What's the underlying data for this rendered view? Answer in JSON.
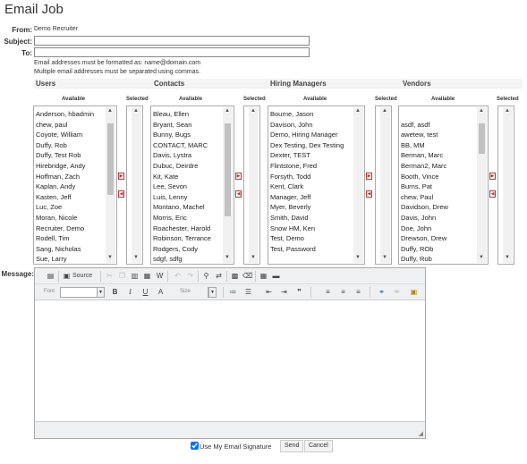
{
  "page_title": "Email Job",
  "from": {
    "label": "From:",
    "value": "Demo Recruiter"
  },
  "subject": {
    "label": "Subject:",
    "value": ""
  },
  "to": {
    "label": "To:",
    "value": ""
  },
  "notes": [
    "Email addresses must be formatted as: name@domain.com",
    "Multiple email addresses must be separated using commas."
  ],
  "columns": [
    {
      "title": "Users",
      "available": "Available",
      "selected": "Selected",
      "items": [
        "Anderson, hbadmin",
        "chew, paul",
        "Coyote, William",
        "Duffy, Rob",
        "Duffy, Test Rob",
        "Hirebridge, Andy",
        "Hoffman, Zach",
        "Kaplan, Andy",
        "Kasten, Jeff",
        "Luc, Zoe",
        "Moran, Nicole",
        "Recruiter, Demo",
        "Rodell, Tim",
        "Sang, Nicholas",
        "Sue, Larry"
      ]
    },
    {
      "title": "Contacts",
      "available": "Available",
      "selected": "Selected",
      "items": [
        "Bleau, Ellen",
        "Bryant, Sean",
        "Bunny, Bugs",
        "CONTACT, MARC",
        "Davis, Lystra",
        "Dubuc, Deirdre",
        "Kit, Kate",
        "Lee, Sevon",
        "Luis, Lenny",
        "Montano, Machel",
        "Morris, Eric",
        "Roachester, Harold",
        "Robinson, Terrance",
        "Rodgers, Cody",
        "sdgf, sdfg"
      ]
    },
    {
      "title": "Hiring Managers",
      "available": "Available",
      "selected": "Selected",
      "items": [
        "Bourne, Jason",
        "Davison, John",
        "Demo, Hiring Manager",
        "Dex Testing, Dex Testing",
        "Dexter, TEST",
        "Flintstone, Fred",
        "Forsyth, Todd",
        "Kent, Clark",
        "Manager, Jeff",
        "Myer, Beverly",
        "Smith, David",
        "Snow HM, Ken",
        "Test, Demo",
        "Test, Password"
      ]
    },
    {
      "title": "Vendors",
      "available": "Available",
      "selected": "Selected",
      "items": [
        "",
        "asdf, asdf",
        "awetew, test",
        "BB, MM",
        "Berman, Marc",
        "Berman2, Marc",
        "Booth, Vince",
        "Burns, Pat",
        "chew, Paul",
        "Davidson, Drew",
        "Davis, John",
        "Doe, John",
        "Drewson, Drew",
        "Duffy, ROb",
        "Duffy, Rob"
      ]
    }
  ],
  "message": {
    "label": "Message:"
  },
  "toolbar": {
    "source": "Source",
    "font": "Font",
    "size": "Size"
  },
  "signature": {
    "label": "Use My Email Signature",
    "checked": true
  },
  "buttons": {
    "send": "Send",
    "cancel": "Cancel"
  }
}
